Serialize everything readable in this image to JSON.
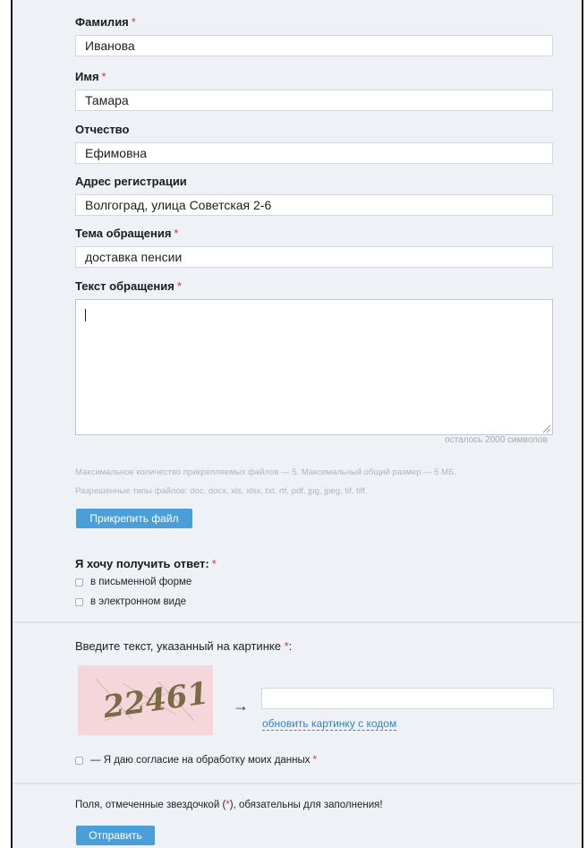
{
  "required_mark": "*",
  "fields": {
    "surname": {
      "label": "Фамилия",
      "value": "Иванова"
    },
    "name": {
      "label": "Имя",
      "value": "Тамара"
    },
    "patronymic": {
      "label": "Отчество",
      "value": "Ефимовна"
    },
    "address": {
      "label": "Адрес регистрации",
      "value": "Волгоград, улица Советская 2-6"
    },
    "subject": {
      "label": "Тема обращения",
      "value": "доставка пенсии"
    },
    "message": {
      "label": "Текст обращения",
      "value": "",
      "counter": "осталось 2000 символов"
    }
  },
  "attachments": {
    "hint_line1": "Максимальное количество прикрепляемых файлов — 5. Максимальный общий размер — 5 МБ.",
    "hint_line2": "Разрешенные типы файлов: doc, docx, xls, xlsx, txt, rtf, pdf, jpg, jpeg, tif, tiff.",
    "button_label": "Прикрепить файл"
  },
  "response": {
    "label": "Я хочу получить ответ:",
    "options": [
      "в письменной форме",
      "в электронном виде"
    ]
  },
  "captcha": {
    "label": "Введите текст, указанный на картинке",
    "label_suffix": ":",
    "image_text": "22461",
    "arrow": "→",
    "input_value": "",
    "refresh_link": "обновить картинку с кодом"
  },
  "consent": {
    "label": "— Я даю согласие на обработку моих данных"
  },
  "footer": {
    "note_before": "Поля, отмеченные звездочкой (",
    "note_after": "), обязательны для заполнения!",
    "submit_label": "Отправить"
  },
  "colors": {
    "accent": "#4a9fd9",
    "required": "#e0333f",
    "link": "#3186c2",
    "background": "#eef1f5"
  }
}
